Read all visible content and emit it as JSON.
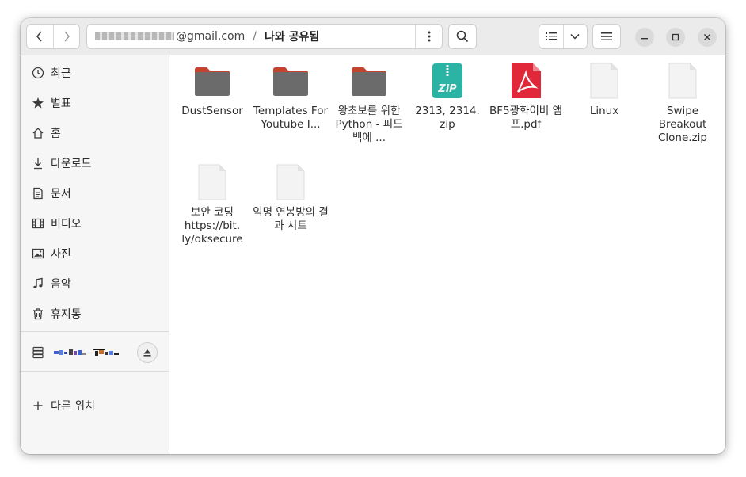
{
  "toolbar": {
    "back_icon": "chevron-left-icon",
    "forward_icon": "chevron-right-icon",
    "path_account": "@gmail.com",
    "path_separator": "/",
    "path_current": "나와 공유됨",
    "path_menu_icon": "vertical-dots-icon",
    "search_icon": "search-icon",
    "list_view_icon": "list-view-icon",
    "view_options_icon": "chevron-down-icon",
    "main_menu_icon": "hamburger-icon"
  },
  "window_controls": {
    "minimize_icon": "minimize-icon",
    "maximize_icon": "maximize-icon",
    "close_icon": "close-icon"
  },
  "sidebar": {
    "items": [
      {
        "label": "최근",
        "icon": "clock-icon"
      },
      {
        "label": "별표",
        "icon": "star-icon"
      },
      {
        "label": "홈",
        "icon": "home-icon"
      },
      {
        "label": "다운로드",
        "icon": "download-icon"
      },
      {
        "label": "문서",
        "icon": "document-icon"
      },
      {
        "label": "비디오",
        "icon": "video-icon"
      },
      {
        "label": "사진",
        "icon": "image-icon"
      },
      {
        "label": "음악",
        "icon": "music-icon"
      },
      {
        "label": "휴지통",
        "icon": "trash-icon"
      }
    ],
    "drive_icon": "drive-icon",
    "eject_icon": "eject-icon",
    "other_locations": {
      "label": "다른 위치",
      "icon": "plus-icon"
    }
  },
  "files": [
    {
      "name": "DustSensor",
      "type": "folder"
    },
    {
      "name": "Templates For Youtube I...",
      "type": "folder"
    },
    {
      "name": "왕초보를 위한 Python - 피드백에 ...",
      "type": "folder"
    },
    {
      "name": "2313, 2314. zip",
      "type": "zip"
    },
    {
      "name": "BF5광화이버 앰프.pdf",
      "type": "pdf"
    },
    {
      "name": "Linux",
      "type": "document"
    },
    {
      "name": "Swipe Breakout Clone.zip",
      "type": "document"
    },
    {
      "name": "보안 코딩 https://bit. ly/oksecure",
      "type": "document"
    },
    {
      "name": "익명 연봉방의 결과 시트",
      "type": "document"
    }
  ],
  "colors": {
    "folder_body": "#6b6b6b",
    "folder_tab": "#c4432f",
    "zip_teal": "#2bb3a3",
    "pdf_red": "#e0283a",
    "document_bg": "#f3f3f3"
  }
}
